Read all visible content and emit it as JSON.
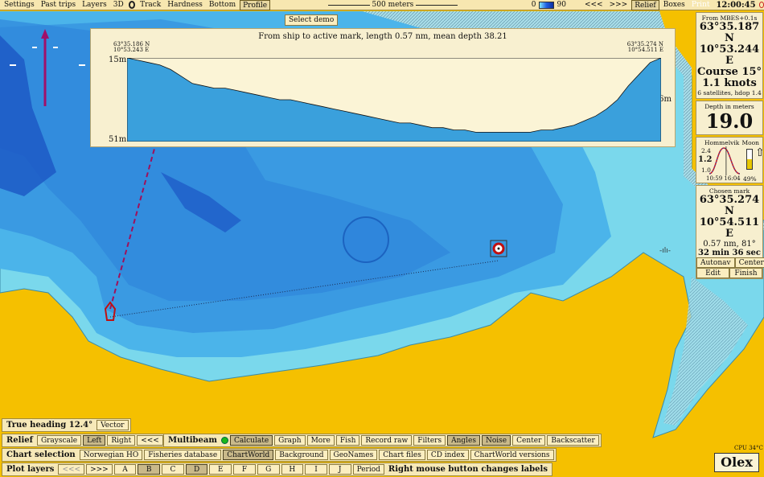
{
  "topbar": {
    "items": [
      "Settings",
      "Past trips",
      "Layers",
      "3D",
      "Track",
      "Hardness",
      "Bottom",
      "Profile"
    ],
    "scale_label": "500 meters",
    "depth_min": "0",
    "depth_max": "90",
    "nav_prev": "<<<",
    "nav_next": ">>>",
    "relief": "Relief",
    "boxes": "Boxes",
    "print": "Print",
    "clock": "12:00:45"
  },
  "select_demo": "Select demo",
  "profile": {
    "title": "From ship to active mark, length 0.57 nm, mean depth 38.21",
    "left_lat": "63°35.186 N",
    "left_lon": "10°53.243 E",
    "right_lat": "63°35.274 N",
    "right_lon": "10°54.511 E",
    "top_depth": "15m",
    "bottom_depth": "51m",
    "right_depth": "36m",
    "depths": [
      15,
      16,
      17,
      18,
      20,
      23,
      26,
      27,
      28,
      28,
      29,
      30,
      31,
      32,
      33,
      33,
      34,
      35,
      36,
      37,
      38,
      39,
      40,
      41,
      42,
      43,
      43,
      44,
      45,
      45,
      46,
      46,
      47,
      47,
      47,
      47,
      47,
      47,
      46,
      46,
      45,
      44,
      42,
      40,
      37,
      33,
      27,
      22,
      17,
      15
    ]
  },
  "gps": {
    "source": "From MBES+0.1s",
    "lat": "63°35.187 N",
    "lon": "10°53.244 E",
    "course": "Course 15°",
    "speed": "1.1 knots",
    "info": "6 satellites, hdop 1.4"
  },
  "depth": {
    "label": "Depth in meters",
    "value": "19.0"
  },
  "tide": {
    "place": "Hommelvik",
    "moon": "Moon",
    "high": "2.4",
    "current": "1.2",
    "low": "1.0",
    "t1": "10:59",
    "t2": "16:04",
    "moon_pct": "49%",
    "level": 0.55,
    "moon_fraction": 0.49
  },
  "mark": {
    "label": "Chosen mark",
    "lat": "63°35.274 N",
    "lon": "10°54.511 E",
    "dist": "0.57 nm, 81°",
    "eta": "32 min 36 sec",
    "autonav": "Autonav",
    "center": "Center",
    "edit": "Edit",
    "finish": "Finish"
  },
  "heading": {
    "label": "True heading 12.4°",
    "vector": "Vector"
  },
  "relief": {
    "label": "Relief",
    "buttons": [
      "Grayscale",
      "Left",
      "Right",
      "<<<",
      ">>>"
    ],
    "active": "Left"
  },
  "multibeam": {
    "label": "Multibeam",
    "buttons": [
      "Calculate",
      "Graph",
      "More",
      "Fish",
      "Record raw",
      "Filters",
      "Angles",
      "Noise",
      "Center",
      "Backscatter"
    ],
    "active": [
      "Calculate",
      "Angles",
      "Noise"
    ]
  },
  "chart_selection": {
    "label": "Chart selection",
    "buttons": [
      "Norwegian HO",
      "Fisheries database",
      "ChartWorld",
      "Background",
      "GeoNames",
      "Chart files",
      "CD index",
      "ChartWorld versions"
    ],
    "active": "ChartWorld"
  },
  "plot_layers": {
    "label": "Plot layers",
    "buttons": [
      "<<<",
      ">>>",
      "A",
      "B",
      "C",
      "D",
      "E",
      "F",
      "G",
      "H",
      "I",
      "J",
      "Period"
    ],
    "active": [
      "B",
      "D"
    ],
    "note": "Right mouse button changes labels"
  },
  "cpu": "CPU 34°C",
  "logo": "Olex"
}
